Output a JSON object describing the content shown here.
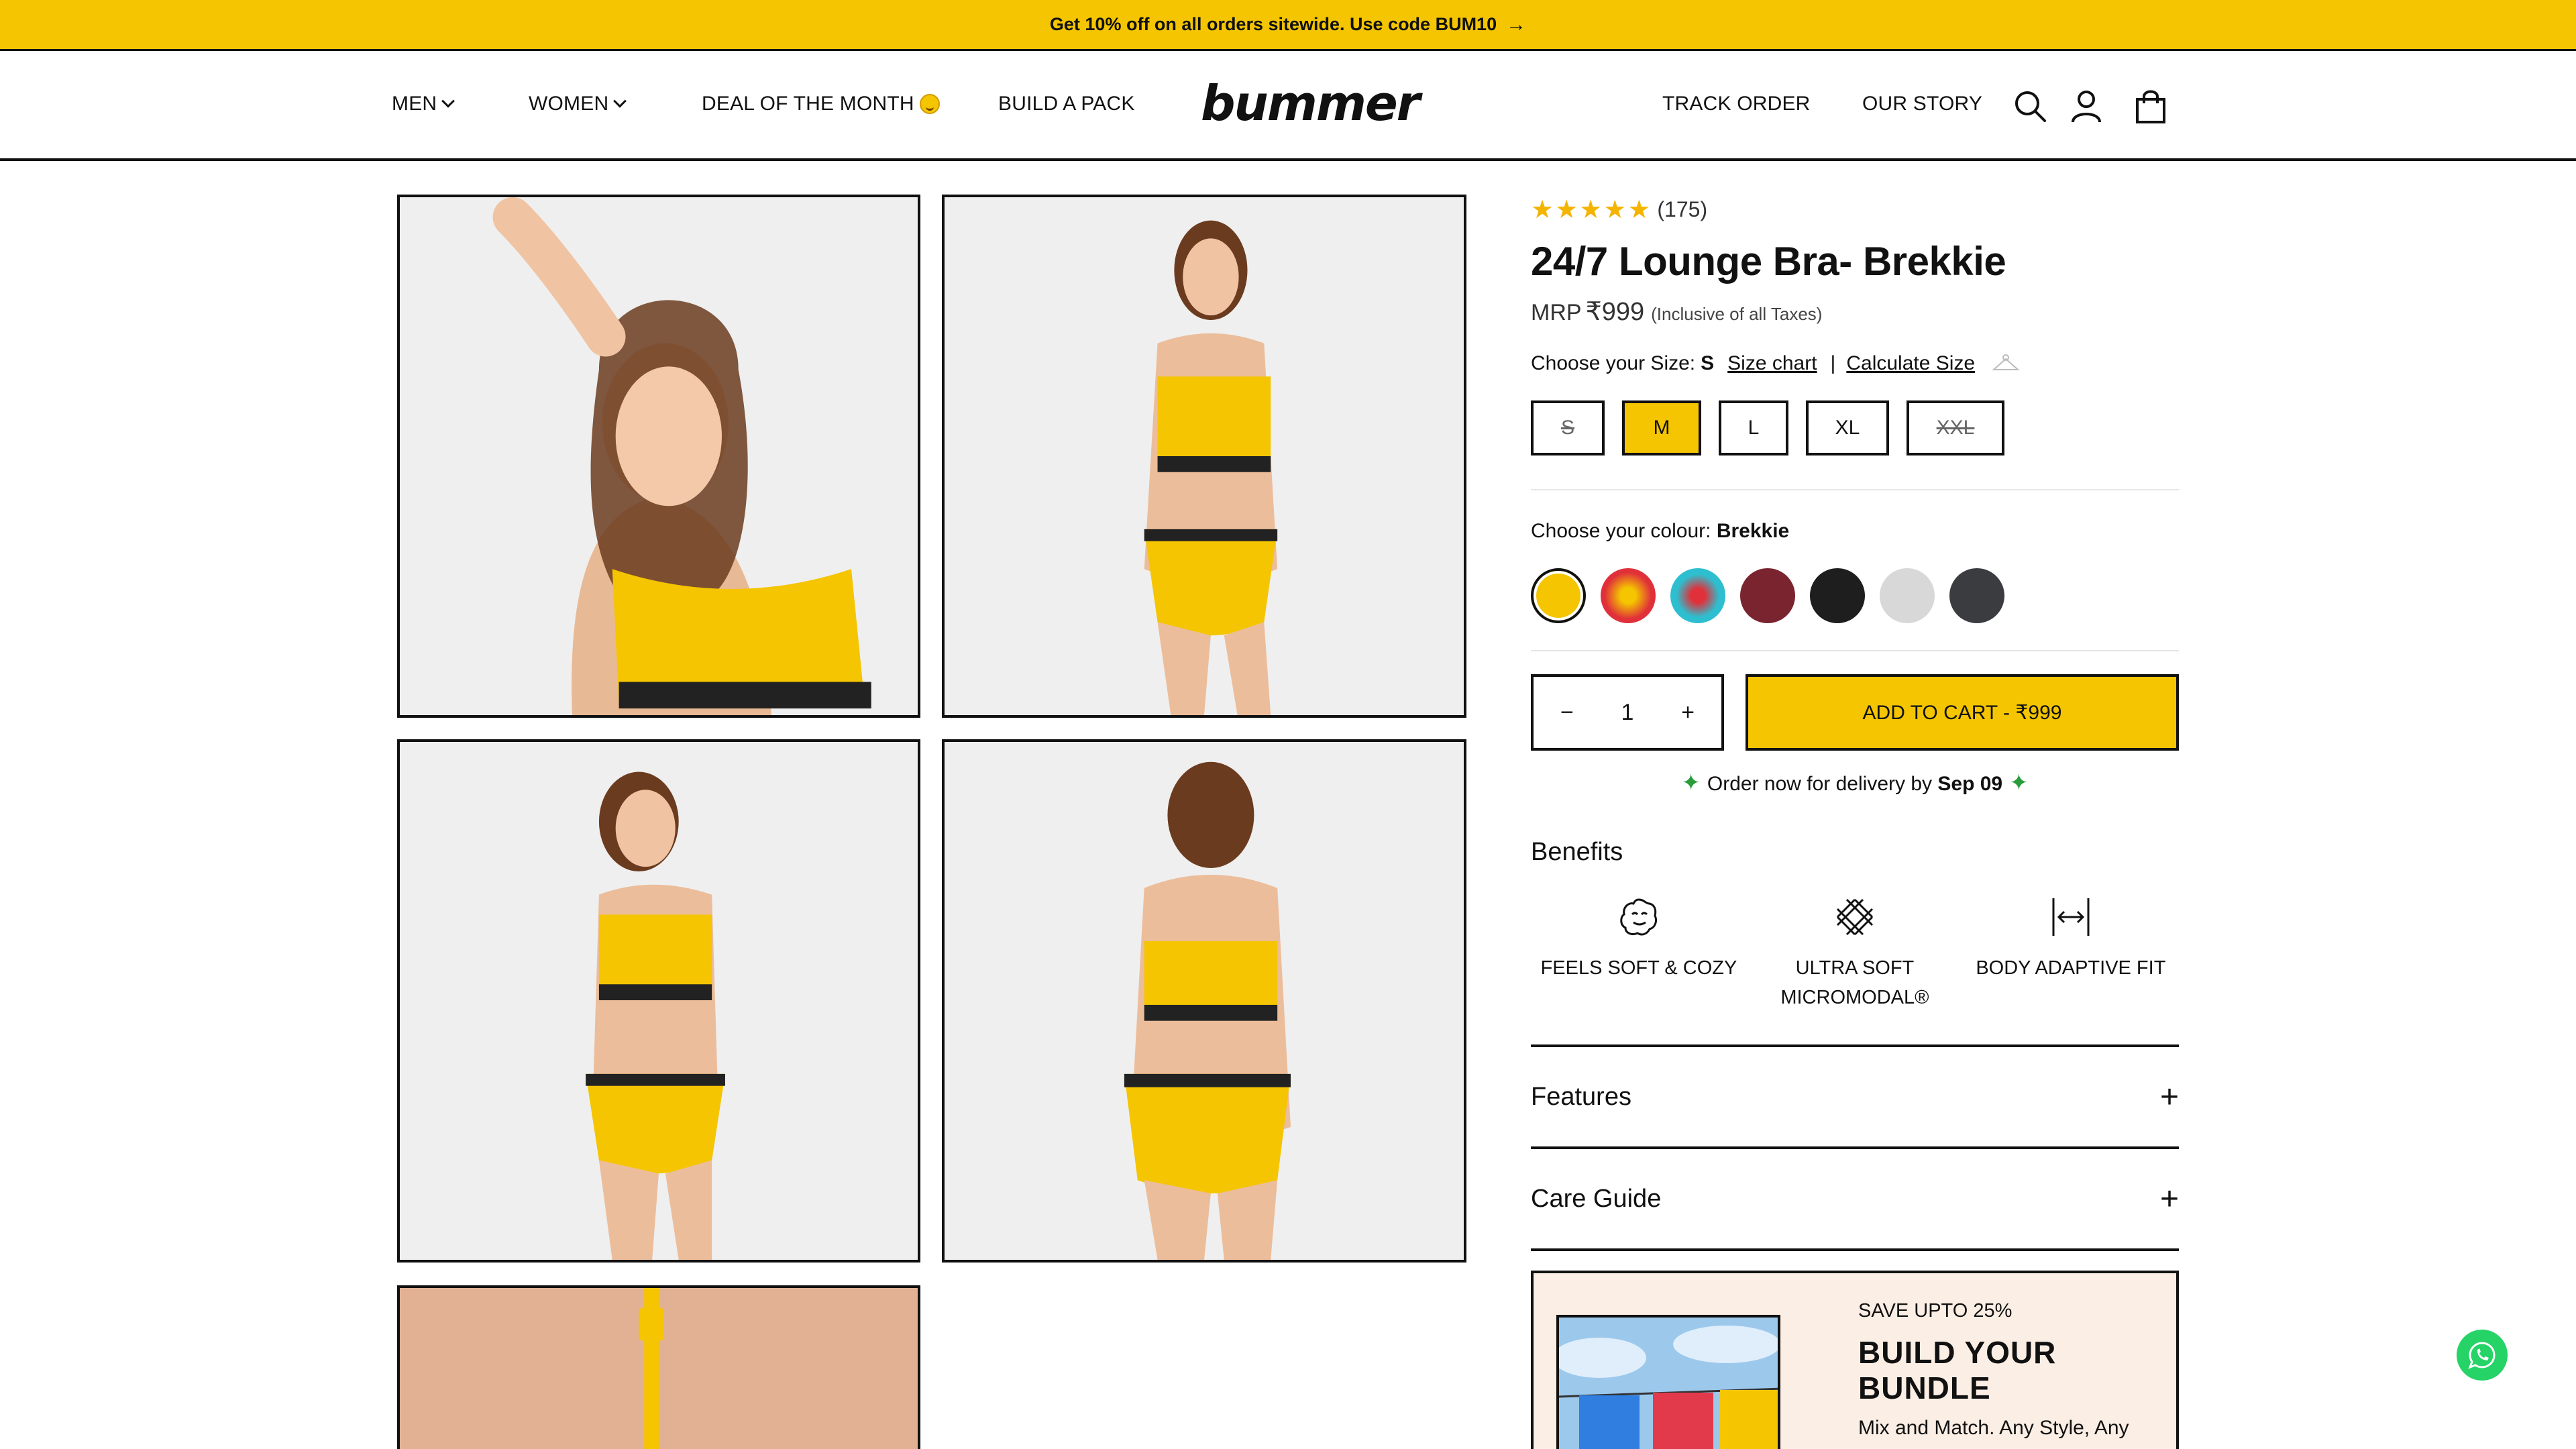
{
  "announcement": {
    "text": "Get 10% off on all orders sitewide. Use code BUM10"
  },
  "nav": {
    "men": "MEN",
    "women": "WOMEN",
    "deal": "DEAL OF THE MONTH",
    "pack": "BUILD A PACK",
    "logo": "bummer",
    "track": "TRACK ORDER",
    "story": "OUR STORY"
  },
  "product": {
    "rating_count": "(175)",
    "title": "24/7 Lounge Bra- Brekkie",
    "mrp_label": "MRP",
    "price": "₹999",
    "tax_note": "(Inclusive of all Taxes)",
    "size_label": "Choose your Size:",
    "size_selected": "S",
    "size_chart": "Size chart",
    "calc_size": "Calculate Size",
    "sizes": [
      "S",
      "M",
      "L",
      "XL",
      "XXL"
    ],
    "colour_label": "Choose your colour:",
    "colour_selected": "Brekkie",
    "colours": [
      "#F4C500",
      "#E0303A",
      "#2DBFD0",
      "#7A2430",
      "#1E1E1E",
      "#D8D8D8",
      "#3A3C40"
    ],
    "quantity": "1",
    "qty_minus": "−",
    "qty_plus": "+",
    "add_to_cart": "ADD TO CART - ₹999",
    "delivery_prefix": "Order now for delivery by",
    "delivery_date": "Sep 09",
    "benefits_title": "Benefits",
    "benefits": [
      "FEELS SOFT & COZY",
      "ULTRA SOFT MICROMODAL®",
      "BODY ADAPTIVE FIT"
    ],
    "accordion": [
      "Features",
      "Care Guide"
    ]
  },
  "bundle": {
    "save": "SAVE UPTO 25%",
    "title": "BUILD YOUR BUNDLE",
    "desc": "Mix and Match. Any Style, Any"
  },
  "icons": [
    "search-icon",
    "user-icon",
    "bag-icon",
    "whatsapp-icon",
    "star-icon",
    "sparkle-icon",
    "plus-icon"
  ],
  "colors": {
    "accent": "#F4C500",
    "border": "#111111",
    "bundle_bg": "#FBEEE4"
  }
}
